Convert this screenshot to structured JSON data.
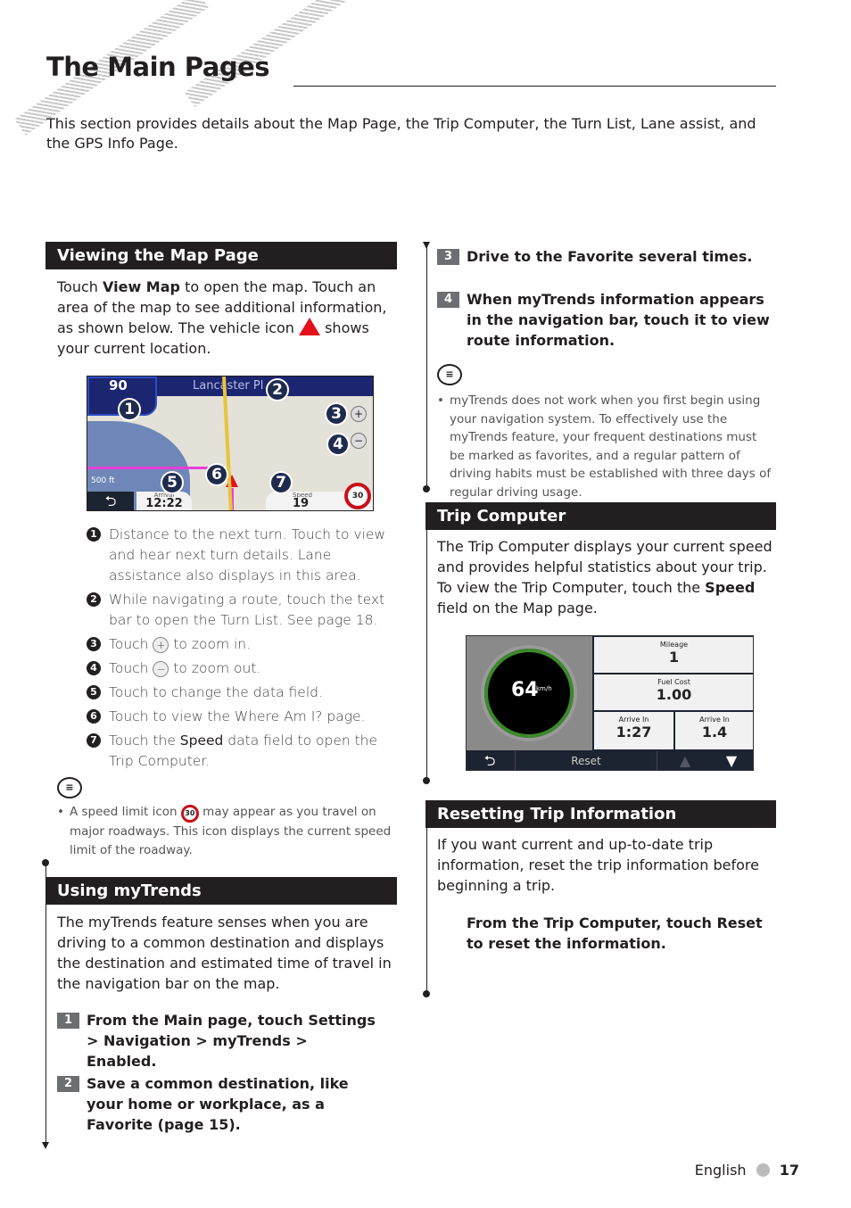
{
  "page": {
    "title": "The Main Pages",
    "intro": "This section provides details about the Map Page, the Trip Computer, the Turn List, Lane assist, and the GPS Info Page."
  },
  "map_section": {
    "heading": "Viewing the Map Page",
    "p1": "Touch ",
    "p1_bold": "View Map",
    "p1_rest": " to open the map. Touch an area of the map to see additional information, as shown below. The vehicle icon ",
    "p1_end": " shows your current location.",
    "screen": {
      "turn_distance": "90",
      "street": "Lancaster Pl",
      "scale": "500 ft",
      "arrival_label": "Arrival",
      "arrival": "12:22",
      "speed_label": "Speed",
      "speed": "19",
      "speed_limit": "30"
    },
    "items": [
      {
        "n": "1",
        "text": "Distance to the next turn. Touch to view and hear next turn details. Lane assistance also displays in this area."
      },
      {
        "n": "2",
        "text": "While navigating a route, touch the text bar to open the Turn List. See page 18."
      },
      {
        "n": "3",
        "pre": "Touch ",
        "post": " to zoom in."
      },
      {
        "n": "4",
        "pre": "Touch ",
        "post": " to zoom out."
      },
      {
        "n": "5",
        "text": "Touch to change the data field."
      },
      {
        "n": "6",
        "text": "Touch to view the Where Am I? page."
      },
      {
        "n": "7",
        "pre": "Touch the ",
        "bold": "Speed",
        "post": " data field to open the Trip Computer."
      }
    ],
    "note_pre": "A speed limit icon ",
    "note_icon": "30",
    "note_post": " may appear as you travel on major roadways. This icon displays the current speed limit of the roadway."
  },
  "mytrends": {
    "heading": "Using myTrends",
    "body": "The myTrends feature senses when you are driving to a common destination and displays the destination and estimated time of travel in the navigation bar on the map.",
    "steps": [
      {
        "n": "1",
        "text": "From the Main page, touch Settings > Navigation > myTrends > Enabled."
      },
      {
        "n": "2",
        "text": "Save a common destination, like your home or workplace, as a Favorite (page 15)."
      },
      {
        "n": "3",
        "text": "Drive to the Favorite several times."
      },
      {
        "n": "4",
        "text": "When myTrends information appears in the navigation bar, touch it to view route information."
      }
    ],
    "note": "myTrends does not work when you first begin using your navigation system. To effectively use the myTrends feature, your frequent destinations must be marked as favorites, and a regular pattern of driving habits must be established with three days of regular driving usage."
  },
  "trip": {
    "heading": "Trip Computer",
    "pre": "The Trip Computer displays your current speed and provides helpful statistics about your trip. To view the Trip Computer, touch the ",
    "bold": "Speed",
    "post": " field on the Map page.",
    "screen": {
      "speed": "64",
      "unit": "km/h",
      "mileage_label": "Mileage",
      "mileage": "1",
      "fuel_label": "Fuel Cost",
      "fuel": "1.00",
      "arrive1_label": "Arrive In",
      "arrive1": "1:27",
      "arrive2_label": "Arrive In",
      "arrive2": "1.4",
      "reset": "Reset"
    }
  },
  "reset": {
    "heading": "Resetting Trip Information",
    "body": "If you want current and up-to-date trip information, reset the trip information before beginning a trip.",
    "step": "From the Trip Computer, touch Reset to reset the information."
  },
  "footer": {
    "language": "English",
    "page": "17"
  }
}
